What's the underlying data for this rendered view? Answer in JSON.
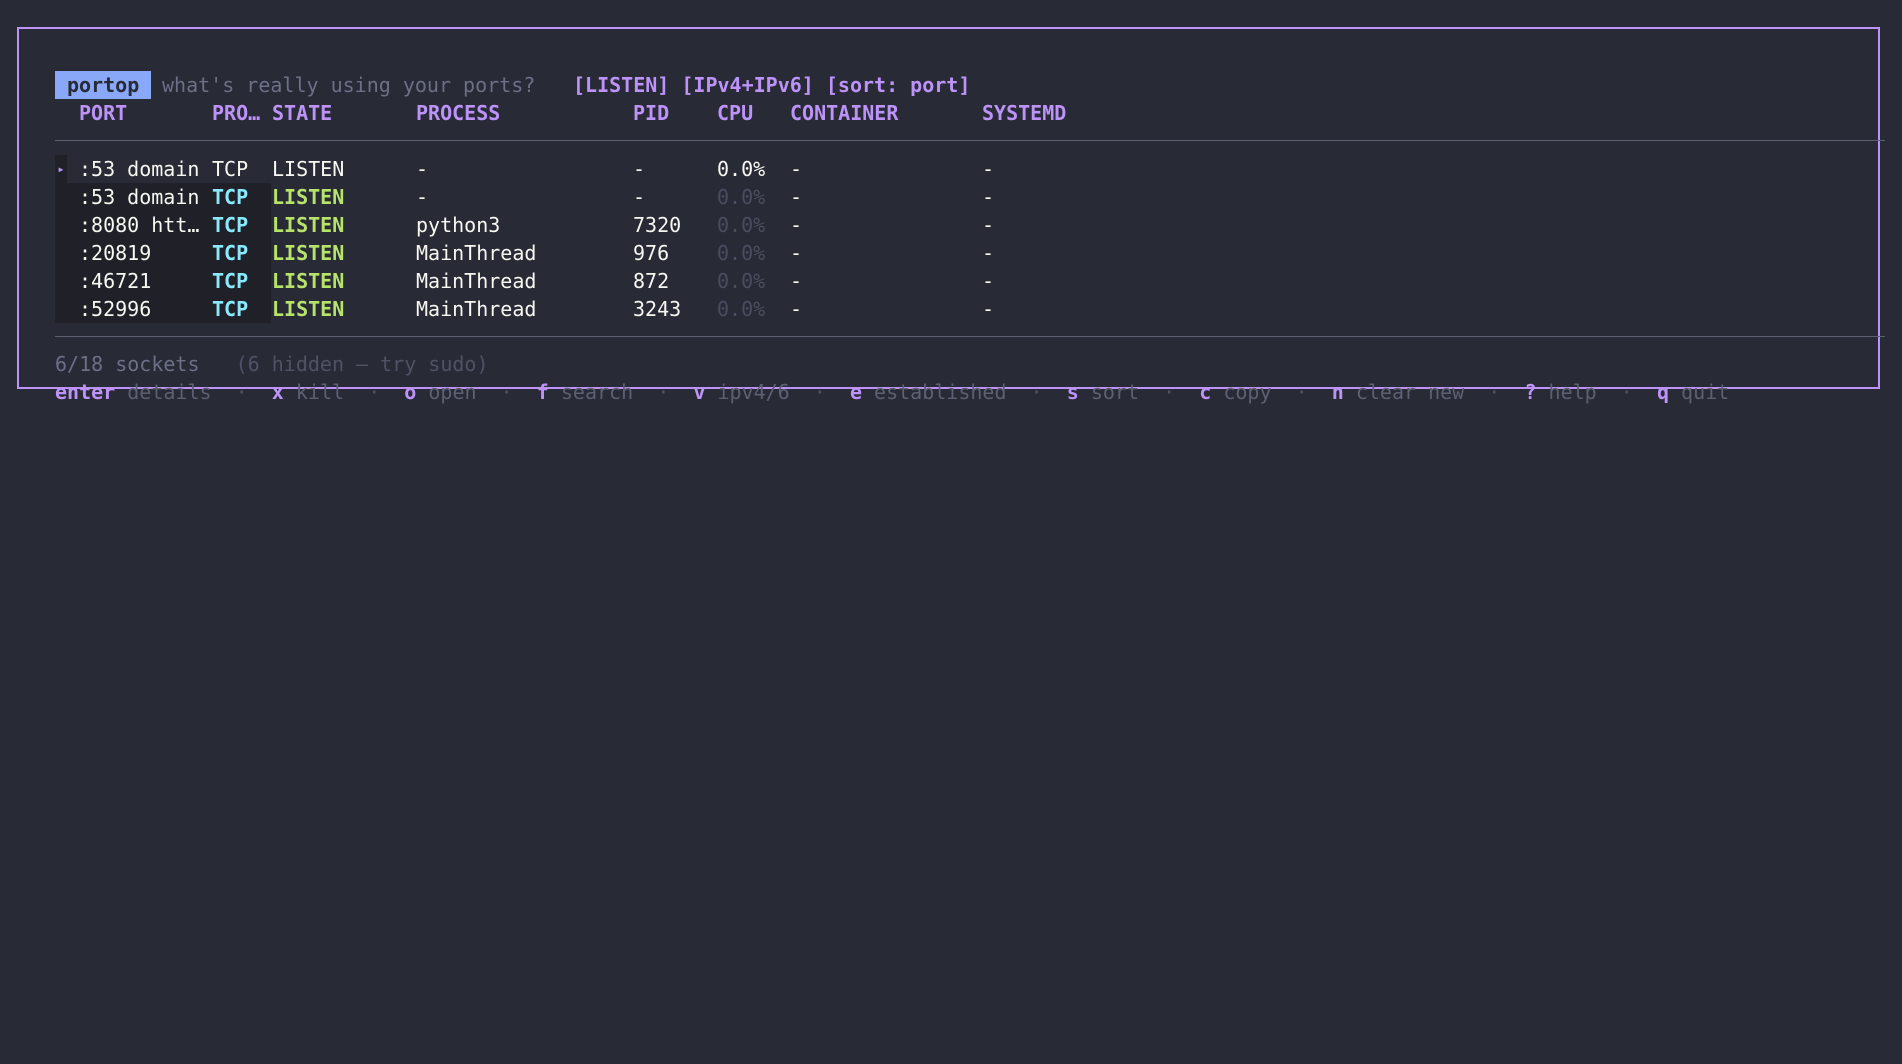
{
  "app": {
    "name": "portop",
    "tagline": "what's really using your ports?",
    "filters": "[LISTEN] [IPv4+IPv6] [sort: port]"
  },
  "columns": {
    "port": "PORT",
    "proto": "PRO…",
    "state": "STATE",
    "process": "PROCESS",
    "pid": "PID",
    "cpu": "CPU",
    "container": "CONTAINER",
    "systemd": "SYSTEMD"
  },
  "rows": [
    {
      "port": ":53 domain",
      "proto": "TCP",
      "state": "LISTEN",
      "process": "-",
      "pid": "-",
      "cpu": "0.0%",
      "container": "-",
      "systemd": "-",
      "selected": true
    },
    {
      "port": ":53 domain",
      "proto": "TCP",
      "state": "LISTEN",
      "process": "-",
      "pid": "-",
      "cpu": "0.0%",
      "container": "-",
      "systemd": "-"
    },
    {
      "port": ":8080 htt…",
      "proto": "TCP",
      "state": "LISTEN",
      "process": "python3",
      "pid": "7320",
      "cpu": "0.0%",
      "container": "-",
      "systemd": "-"
    },
    {
      "port": ":20819",
      "proto": "TCP",
      "state": "LISTEN",
      "process": "MainThread",
      "pid": "976",
      "cpu": "0.0%",
      "container": "-",
      "systemd": "-"
    },
    {
      "port": ":46721",
      "proto": "TCP",
      "state": "LISTEN",
      "process": "MainThread",
      "pid": "872",
      "cpu": "0.0%",
      "container": "-",
      "systemd": "-"
    },
    {
      "port": ":52996",
      "proto": "TCP",
      "state": "LISTEN",
      "process": "MainThread",
      "pid": "3243",
      "cpu": "0.0%",
      "container": "-",
      "systemd": "-"
    }
  ],
  "cursor_glyph": "▸",
  "status": {
    "count": "6/18 sockets",
    "hidden": "(6 hidden — try sudo)"
  },
  "keybinds": [
    {
      "key": "enter",
      "action": "details"
    },
    {
      "key": "x",
      "action": "kill"
    },
    {
      "key": "o",
      "action": "open"
    },
    {
      "key": "f",
      "action": "search"
    },
    {
      "key": "v",
      "action": "ipv4/6"
    },
    {
      "key": "e",
      "action": "established"
    },
    {
      "key": "s",
      "action": "sort"
    },
    {
      "key": "c",
      "action": "copy"
    },
    {
      "key": "n",
      "action": "clear new"
    },
    {
      "key": "?",
      "action": "help"
    },
    {
      "key": "q",
      "action": "quit"
    }
  ],
  "separator": "·",
  "colors": {
    "background": "#282a36",
    "accent": "#bd93f9",
    "badge": "#8aa8f8",
    "proto": "#8be9fd",
    "state": "#b8e36b"
  }
}
